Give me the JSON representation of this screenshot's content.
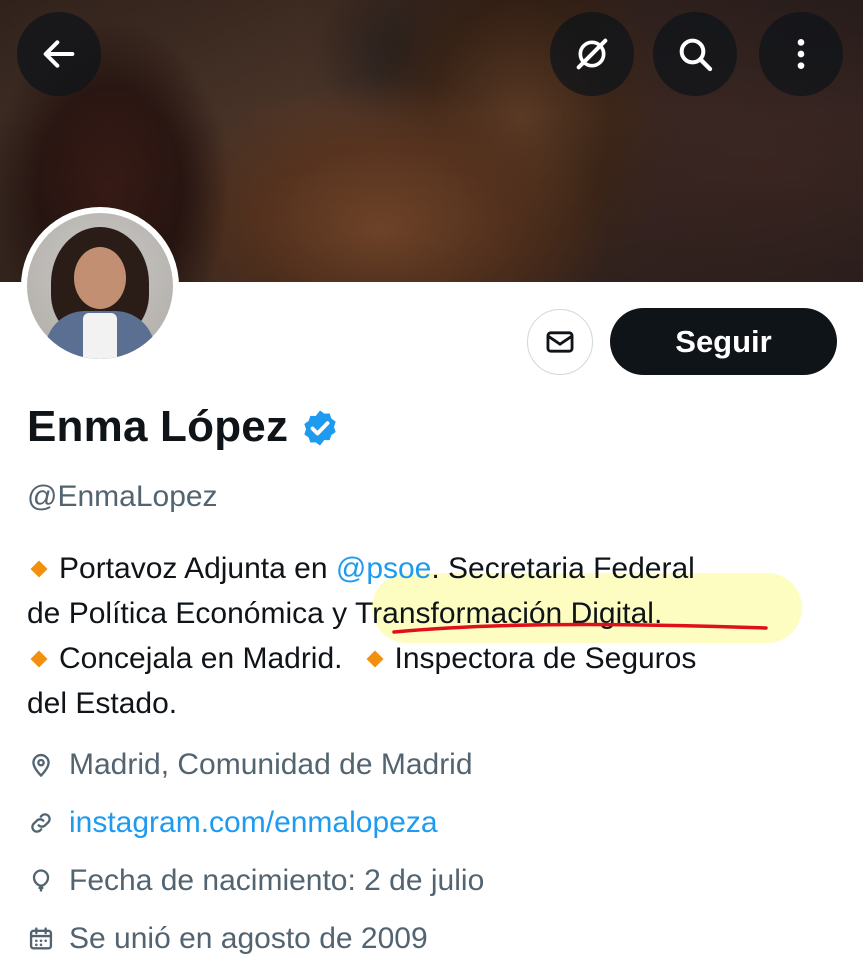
{
  "header": {
    "back_icon": "arrow-left-icon",
    "grok_icon": "grok-icon",
    "search_icon": "search-icon",
    "more_icon": "more-vertical-icon"
  },
  "profile": {
    "name": "Enma López",
    "handle": "@EnmaLopez",
    "verified": true,
    "follow_label": "Seguir",
    "message_icon": "envelope-icon",
    "bio": {
      "line1_prefix": "Portavoz Adjunta en ",
      "mention": "@psoe",
      "line1_suffix": ". Secretaria Federal",
      "line2_prefix": "de Política Económica y ",
      "line2_highlight": "Transformación Digital.",
      "item2": "Concejala en Madrid.",
      "item3": "Inspectora de Seguros",
      "line4": "del Estado."
    },
    "meta": {
      "location": "Madrid, Comunidad de Madrid",
      "website": "instagram.com/enmalopeza",
      "birthday": "Fecha de nacimiento: 2 de julio",
      "joined": "Se unió en agosto de 2009"
    }
  },
  "colors": {
    "accent": "#1d9bf0",
    "text": "#0f1419",
    "secondary": "#536471",
    "bullet": "#f2900e",
    "annotation_underline": "#e0101a",
    "annotation_highlight": "#fafa78"
  }
}
